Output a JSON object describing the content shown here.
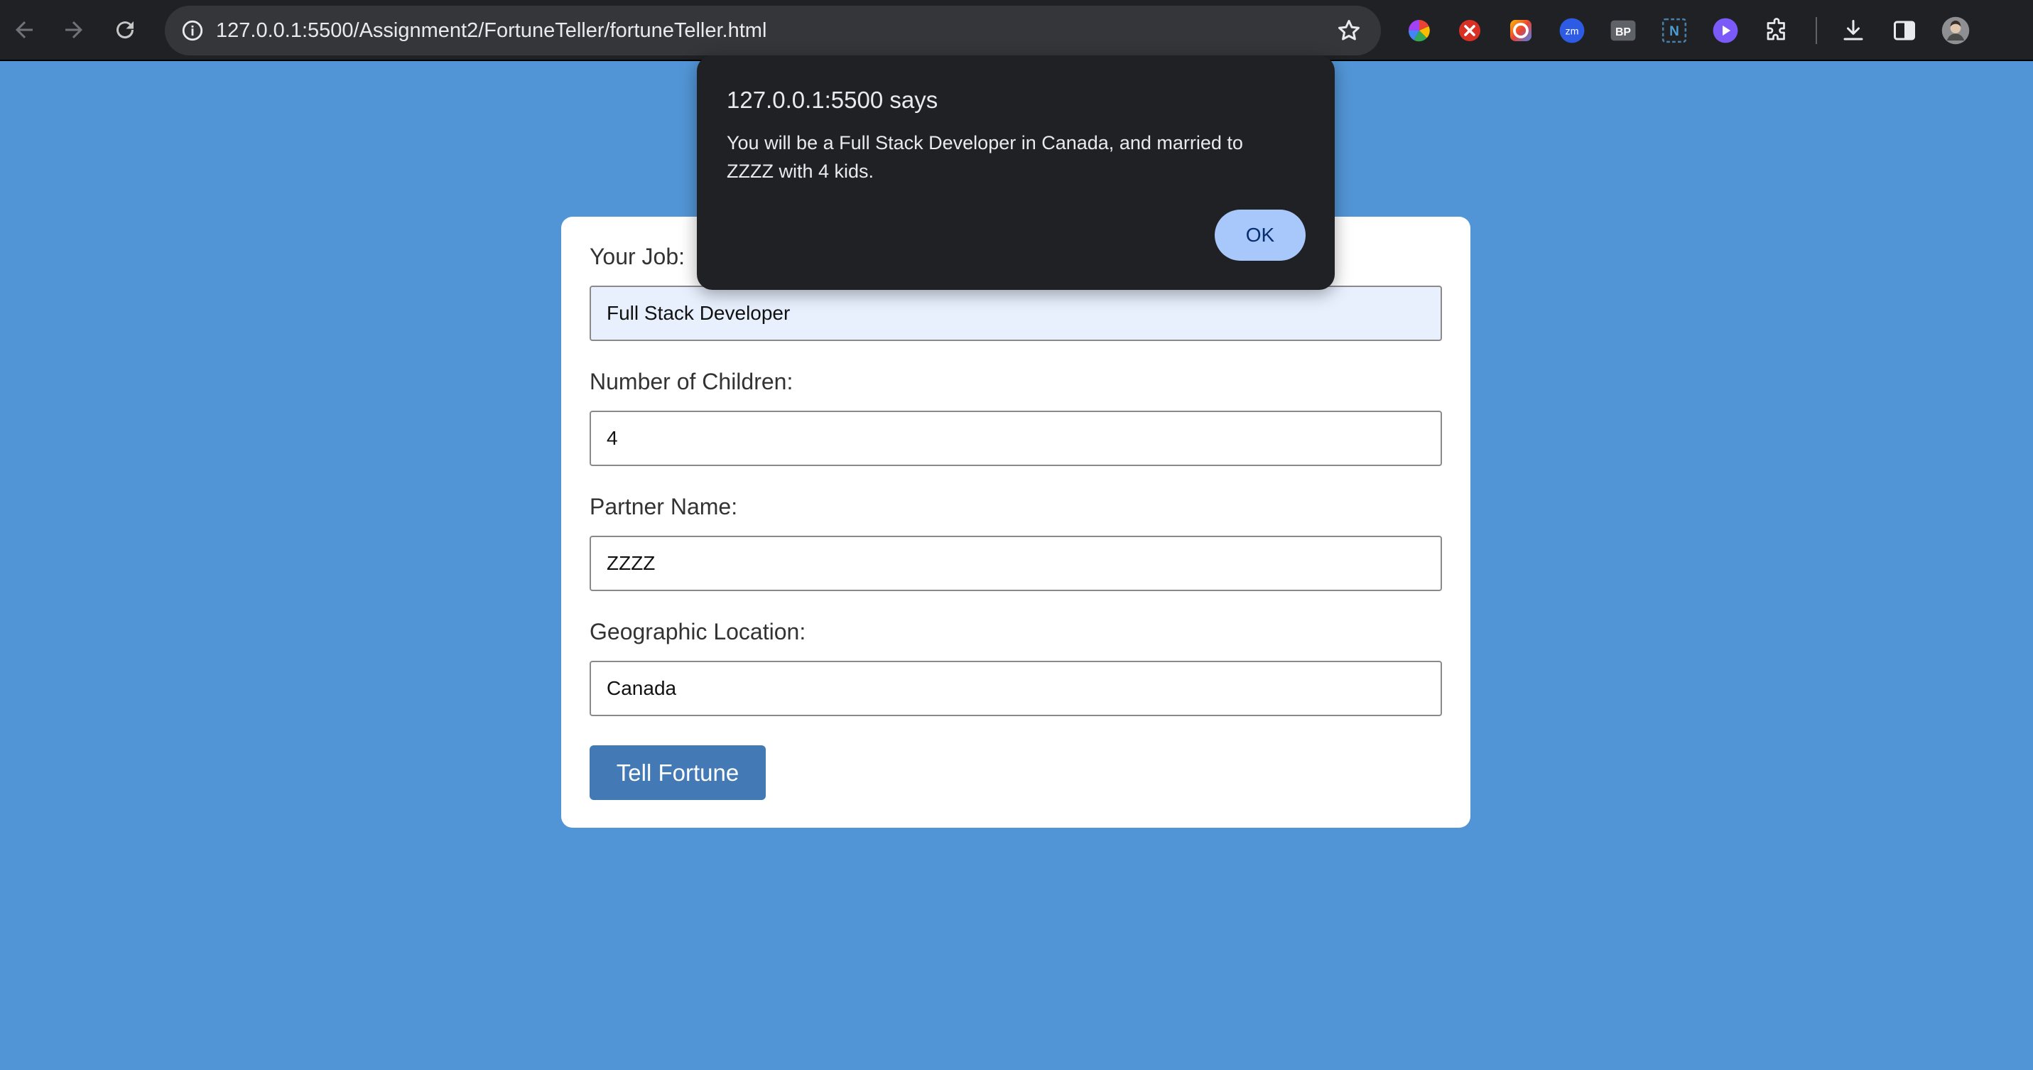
{
  "browser": {
    "url": "127.0.0.1:5500/Assignment2/FortuneTeller/fortuneTeller.html",
    "extension_icons": [
      "color-wheel-icon",
      "red-x-icon",
      "ring-icon",
      "zoom-icon",
      "bp-icon",
      "notion-icon",
      "play-icon",
      "puzzle-icon"
    ],
    "ext_labels": {
      "zm": "zm",
      "bp": "BP",
      "notion": "N"
    }
  },
  "alert": {
    "title": "127.0.0.1:5500 says",
    "message": "You will be a Full Stack Developer in Canada, and married to ZZZZ with 4 kids.",
    "ok_label": "OK"
  },
  "form": {
    "job": {
      "label": "Your Job:",
      "value": "Full Stack Developer"
    },
    "children": {
      "label": "Number of Children:",
      "value": "4"
    },
    "partner": {
      "label": "Partner Name:",
      "value": "ZZZZ"
    },
    "location": {
      "label": "Geographic Location:",
      "value": "Canada"
    },
    "submit_label": "Tell Fortune"
  },
  "colors": {
    "page_background": "#5295d6",
    "button": "#4379b4",
    "dialog_background": "#202124",
    "ok_button": "#a8c7fa"
  }
}
